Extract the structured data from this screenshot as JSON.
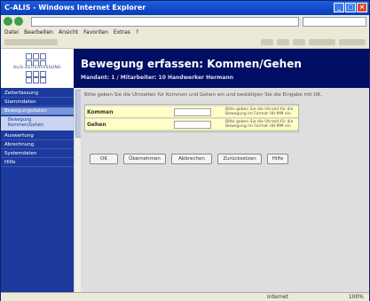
{
  "browser": {
    "title": "C-ALIS - Windows Internet Explorer",
    "menu": [
      "Datei",
      "Bearbeiten",
      "Ansicht",
      "Favoriten",
      "Extras",
      "?"
    ],
    "status_left": "",
    "status_zone": "Internet",
    "status_zoom": "100%"
  },
  "logo": {
    "text": "ALIS-ZEITERFASSUNG"
  },
  "header": {
    "title": "Bewegung erfassen: Kommen/Gehen",
    "subtitle": "Mandant: 1 / Mitarbeiter: 10 Handwerker Hermann"
  },
  "sidebar": {
    "items": [
      "Zeiterfassung",
      "Stammdaten",
      "Bewegungsdaten",
      "Auswertung",
      "Abrechnung",
      "Systemdaten",
      "Hilfe"
    ],
    "sub": "Bewegung\nKommen/Gehen"
  },
  "form": {
    "intro": "Bitte geben Sie die Uhrzeiten für Kommen und Gehen ein und bestätigen Sie die Eingabe mit OK.",
    "rows": [
      {
        "label": "Kommen",
        "value": "",
        "hint": "Bitte geben Sie die Uhrzeit für die Bewegung im Format HH:MM ein"
      },
      {
        "label": "Gehen",
        "value": "",
        "hint": "Bitte geben Sie die Uhrzeit für die Bewegung im Format HH:MM ein"
      }
    ],
    "buttons": [
      "OK",
      "Übernehmen",
      "Abbrechen",
      "Zurücksetzen",
      "Hilfe"
    ]
  }
}
